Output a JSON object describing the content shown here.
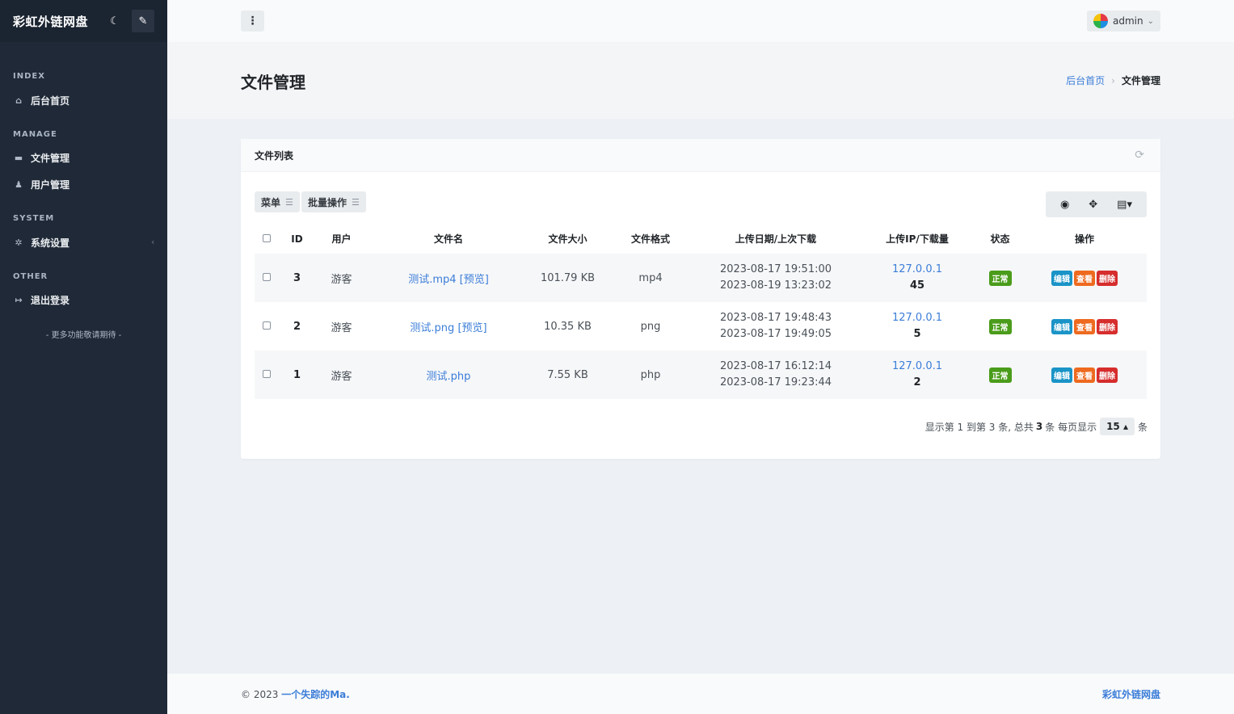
{
  "sidebar": {
    "brand": "彩虹外链网盘",
    "sections": [
      {
        "head": "INDEX",
        "items": [
          {
            "label": "后台首页",
            "icon": "home-icon"
          }
        ]
      },
      {
        "head": "MANAGE",
        "items": [
          {
            "label": "文件管理",
            "icon": "folder-icon"
          },
          {
            "label": "用户管理",
            "icon": "users-icon"
          }
        ]
      },
      {
        "head": "SYSTEM",
        "items": [
          {
            "label": "系统设置",
            "icon": "gear-icon"
          }
        ]
      },
      {
        "head": "OTHER",
        "items": [
          {
            "label": "退出登录",
            "icon": "logout-icon"
          }
        ]
      }
    ],
    "more": "- 更多功能敬请期待 -"
  },
  "header": {
    "user": "admin"
  },
  "page": {
    "title": "文件管理",
    "breadcrumb": {
      "home": "后台首页",
      "current": "文件管理"
    }
  },
  "card": {
    "title": "文件列表",
    "toolbar": {
      "menu": "菜单",
      "batch": "批量操作"
    },
    "columns": [
      "ID",
      "用户",
      "文件名",
      "文件大小",
      "文件格式",
      "上传日期/上次下载",
      "上传IP/下载量",
      "状态",
      "操作"
    ],
    "rows": [
      {
        "id": "3",
        "user": "游客",
        "name": "测试.mp4",
        "preview": "[预览]",
        "size": "101.79 KB",
        "format": "mp4",
        "upload": "2023-08-17 19:51:00",
        "last": "2023-08-19 13:23:02",
        "ip": "127.0.0.1",
        "downloads": "45",
        "status": "正常"
      },
      {
        "id": "2",
        "user": "游客",
        "name": "测试.png",
        "preview": "[预览]",
        "size": "10.35 KB",
        "format": "png",
        "upload": "2023-08-17 19:48:43",
        "last": "2023-08-17 19:49:05",
        "ip": "127.0.0.1",
        "downloads": "5",
        "status": "正常"
      },
      {
        "id": "1",
        "user": "游客",
        "name": "测试.php",
        "preview": "",
        "size": "7.55 KB",
        "format": "php",
        "upload": "2023-08-17 16:12:14",
        "last": "2023-08-17 19:23:44",
        "ip": "127.0.0.1",
        "downloads": "2",
        "status": "正常"
      }
    ],
    "actions": {
      "edit": "编辑",
      "view": "查看",
      "delete": "删除"
    },
    "pager": {
      "prefix": "显示第 1 到第 3 条, 总共",
      "total": "3",
      "suffix": "条  每页显示",
      "per_page": "15",
      "unit": "条"
    }
  },
  "footer": {
    "copyright": "© 2023",
    "author": "一个失踪的Ma.",
    "brand": "彩虹外链网盘"
  },
  "colors": {
    "sidebar": "#1f2937",
    "link": "#3b7dd8",
    "ok": "#4a9c1a",
    "edit": "#1a94c7",
    "view": "#ee6a1f",
    "delete": "#d62d2d"
  }
}
